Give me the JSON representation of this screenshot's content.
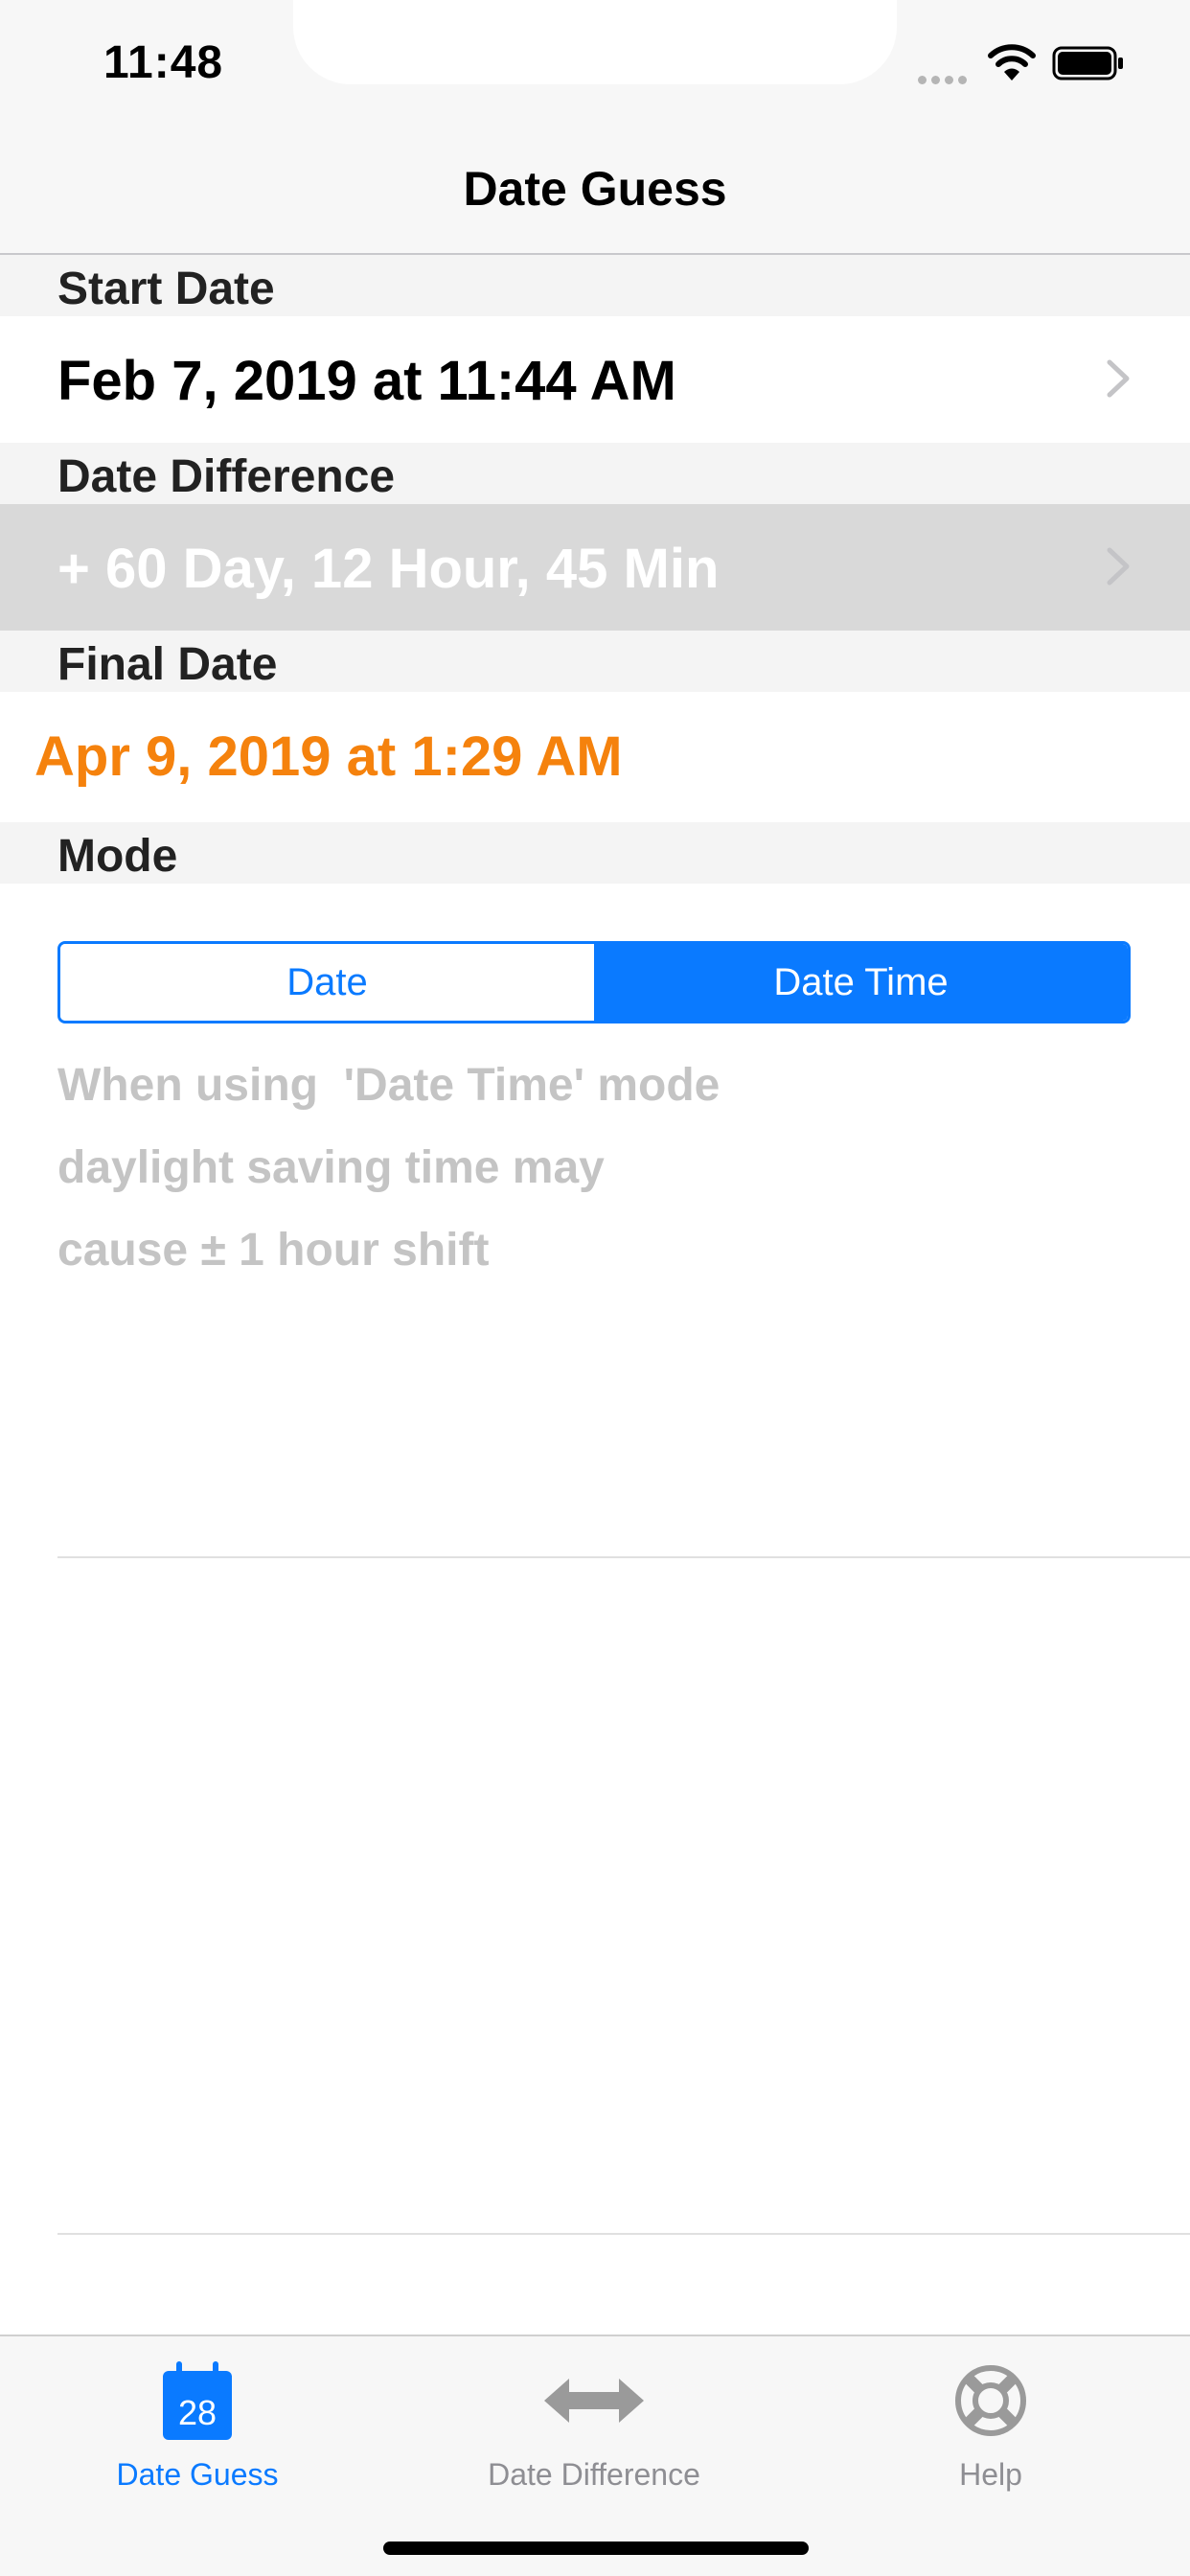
{
  "status_bar": {
    "time": "11:48"
  },
  "nav": {
    "title": "Date Guess"
  },
  "sections": {
    "start_date": {
      "header": "Start Date",
      "value": "Feb 7, 2019 at 11:44 AM"
    },
    "date_difference": {
      "header": "Date Difference",
      "value": "+ 60 Day, 12 Hour, 45 Min"
    },
    "final_date": {
      "header": "Final Date",
      "value": "Apr 9, 2019 at 1:29 AM"
    },
    "mode": {
      "header": "Mode",
      "options": [
        "Date",
        "Date Time"
      ],
      "selected": "Date Time",
      "note_lines": [
        "When using  'Date Time' mode",
        "daylight saving time may",
        "cause ± 1 hour shift"
      ]
    }
  },
  "tab_bar": {
    "tabs": [
      {
        "label": "Date Guess",
        "icon": "calendar-icon",
        "icon_text": "28",
        "active": true
      },
      {
        "label": "Date Difference",
        "icon": "double-arrow-icon",
        "active": false
      },
      {
        "label": "Help",
        "icon": "lifebuoy-icon",
        "active": false
      }
    ]
  },
  "colors": {
    "accent": "#0A7AFF",
    "final_date": "#F5820D",
    "note_text": "#C4C4C4"
  }
}
